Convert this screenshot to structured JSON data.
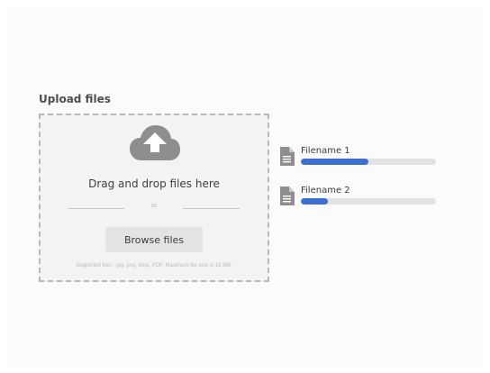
{
  "upload": {
    "title": "Upload files",
    "icon": "cloud-upload-icon",
    "drag_text": "Drag and drop files here",
    "or_text": "or",
    "browse_label": "Browse files",
    "supported_text": "Supported files : jpg, png, bmp, PDF. Maximum file size is 10 MB."
  },
  "files": [
    {
      "name": "Filename 1",
      "icon": "file-icon",
      "progress": 0.5
    },
    {
      "name": "Filename 2",
      "icon": "file-icon",
      "progress": 0.2
    }
  ],
  "colors": {
    "accent": "#3d6fd0",
    "track": "#e2e2e2",
    "icon": "#8e8e8e",
    "dropzone_bg": "#f3f3f3",
    "dropzone_border": "#b9b9b9"
  }
}
